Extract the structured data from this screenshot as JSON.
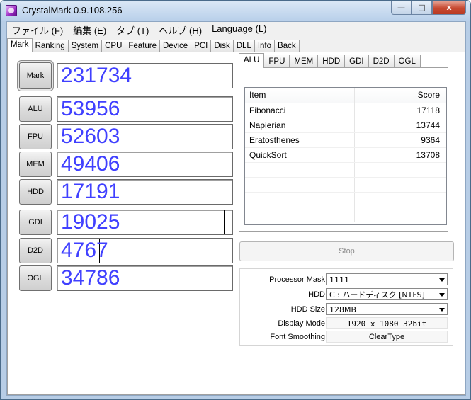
{
  "window": {
    "title": "CrystalMark 0.9.108.256",
    "min_label": "—",
    "max_label": "□",
    "close_label": "x"
  },
  "menu": [
    "ファイル (F)",
    "編集 (E)",
    "タブ (T)",
    "ヘルプ (H)",
    "Language (L)"
  ],
  "tabs": [
    "Mark",
    "Ranking",
    "System",
    "CPU",
    "Feature",
    "Device",
    "PCI",
    "Disk",
    "DLL",
    "Info",
    "Back"
  ],
  "active_tab": "Mark",
  "scores": [
    {
      "label": "Mark",
      "value": "231734",
      "fill": 1.0
    },
    {
      "label": "ALU",
      "value": "53956",
      "fill": 1.0
    },
    {
      "label": "FPU",
      "value": "52603",
      "fill": 1.0
    },
    {
      "label": "MEM",
      "value": "49406",
      "fill": 1.0
    },
    {
      "label": "HDD",
      "value": "17191",
      "fill": 0.86
    },
    {
      "label": "GDI",
      "value": "19025",
      "fill": 0.95
    },
    {
      "label": "D2D",
      "value": "4767",
      "fill": 0.24
    },
    {
      "label": "OGL",
      "value": "34786",
      "fill": 1.0
    }
  ],
  "subtabs": [
    "ALU",
    "FPU",
    "MEM",
    "HDD",
    "GDI",
    "D2D",
    "OGL"
  ],
  "active_subtab": "ALU",
  "results": {
    "header": {
      "item": "Item",
      "score": "Score"
    },
    "rows": [
      {
        "item": "Fibonacci",
        "score": "17118"
      },
      {
        "item": "Napierian",
        "score": "13744"
      },
      {
        "item": "Eratosthenes",
        "score": "9364"
      },
      {
        "item": "QuickSort",
        "score": "13708"
      }
    ]
  },
  "stop_label": "Stop",
  "settings": {
    "processor_mask": {
      "label": "Processor Mask",
      "value": "1111"
    },
    "hdd": {
      "label": "HDD",
      "value": "C : ハードディスク [NTFS]"
    },
    "hdd_size": {
      "label": "HDD Size",
      "value": "128MB"
    },
    "display_mode": {
      "label": "Display Mode",
      "value": "1920 x 1080 32bit"
    },
    "font_smoothing": {
      "label": "Font Smoothing",
      "value": "ClearType"
    }
  }
}
